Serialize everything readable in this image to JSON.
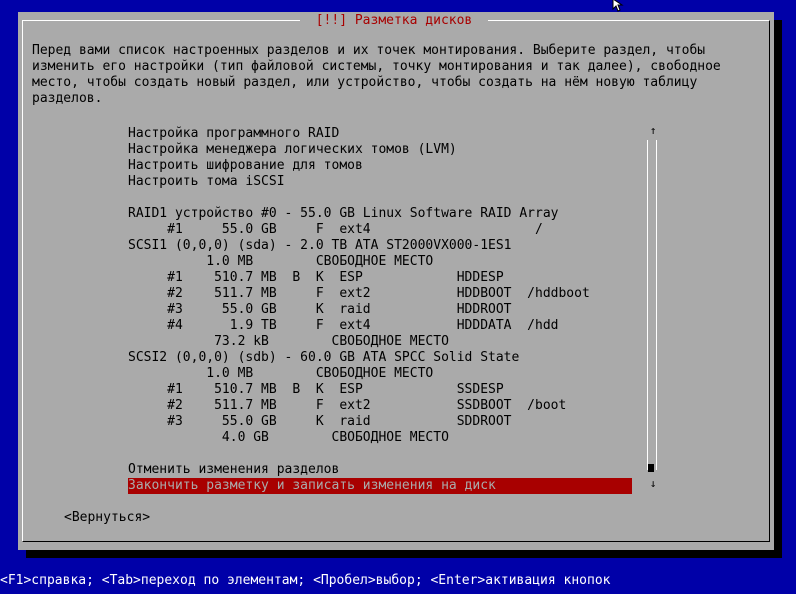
{
  "dialog": {
    "title": "[!!] Разметка дисков",
    "intro": "Перед вами список настроенных разделов и их точек монтирования. Выберите раздел, чтобы\nизменить его настройки (тип файловой системы, точку монтирования и так далее), свободное\nместо, чтобы создать новый раздел, или устройство, чтобы создать на нём новую таблицу\nразделов."
  },
  "partition_list": {
    "rows": [
      "Настройка программного RAID",
      "Настройка менеджера логических томов (LVM)",
      "Настроить шифрование для томов",
      "Настроить тома iSCSI",
      "",
      "RAID1 устройство #0 - 55.0 GB Linux Software RAID Array",
      "     #1     55.0 GB     F  ext4                     /",
      "SCSI1 (0,0,0) (sda) - 2.0 TB ATA ST2000VX000-1ES1",
      "          1.0 MB        СВОБОДНОЕ МЕСТО",
      "     #1    510.7 MB  B  K  ESP            HDDESP",
      "     #2    511.7 MB     F  ext2           HDDBOOT  /hddboot",
      "     #3     55.0 GB     K  raid           HDDROOT",
      "     #4      1.9 TB     F  ext4           HDDDATA  /hdd",
      "           73.2 kB        СВОБОДНОЕ МЕСТО",
      "SCSI2 (0,0,0) (sdb) - 60.0 GB ATA SPCC Solid State",
      "          1.0 MB        СВОБОДНОЕ МЕСТО",
      "     #1    510.7 MB  B  K  ESP            SSDESP",
      "     #2    511.7 MB     F  ext2           SSDBOOT  /boot",
      "     #3     55.0 GB     K  raid           SDDROOT",
      "            4.0 GB        СВОБОДНОЕ МЕСТО",
      "",
      "Отменить изменения разделов",
      "Закончить разметку и записать изменения на диск"
    ],
    "selected_index": 22,
    "scroll_up_glyph": "↑",
    "scroll_down_glyph": "↓"
  },
  "buttons": {
    "back": "<Вернуться>"
  },
  "statusbar": {
    "text": "<F1>справка; <Tab>переход по элементам; <Пробел>выбор; <Enter>активация кнопок"
  },
  "colors": {
    "background": "#0000a8",
    "dialog": "#aaaaaa",
    "selection": "#a80000",
    "title_text": "#a80000"
  }
}
